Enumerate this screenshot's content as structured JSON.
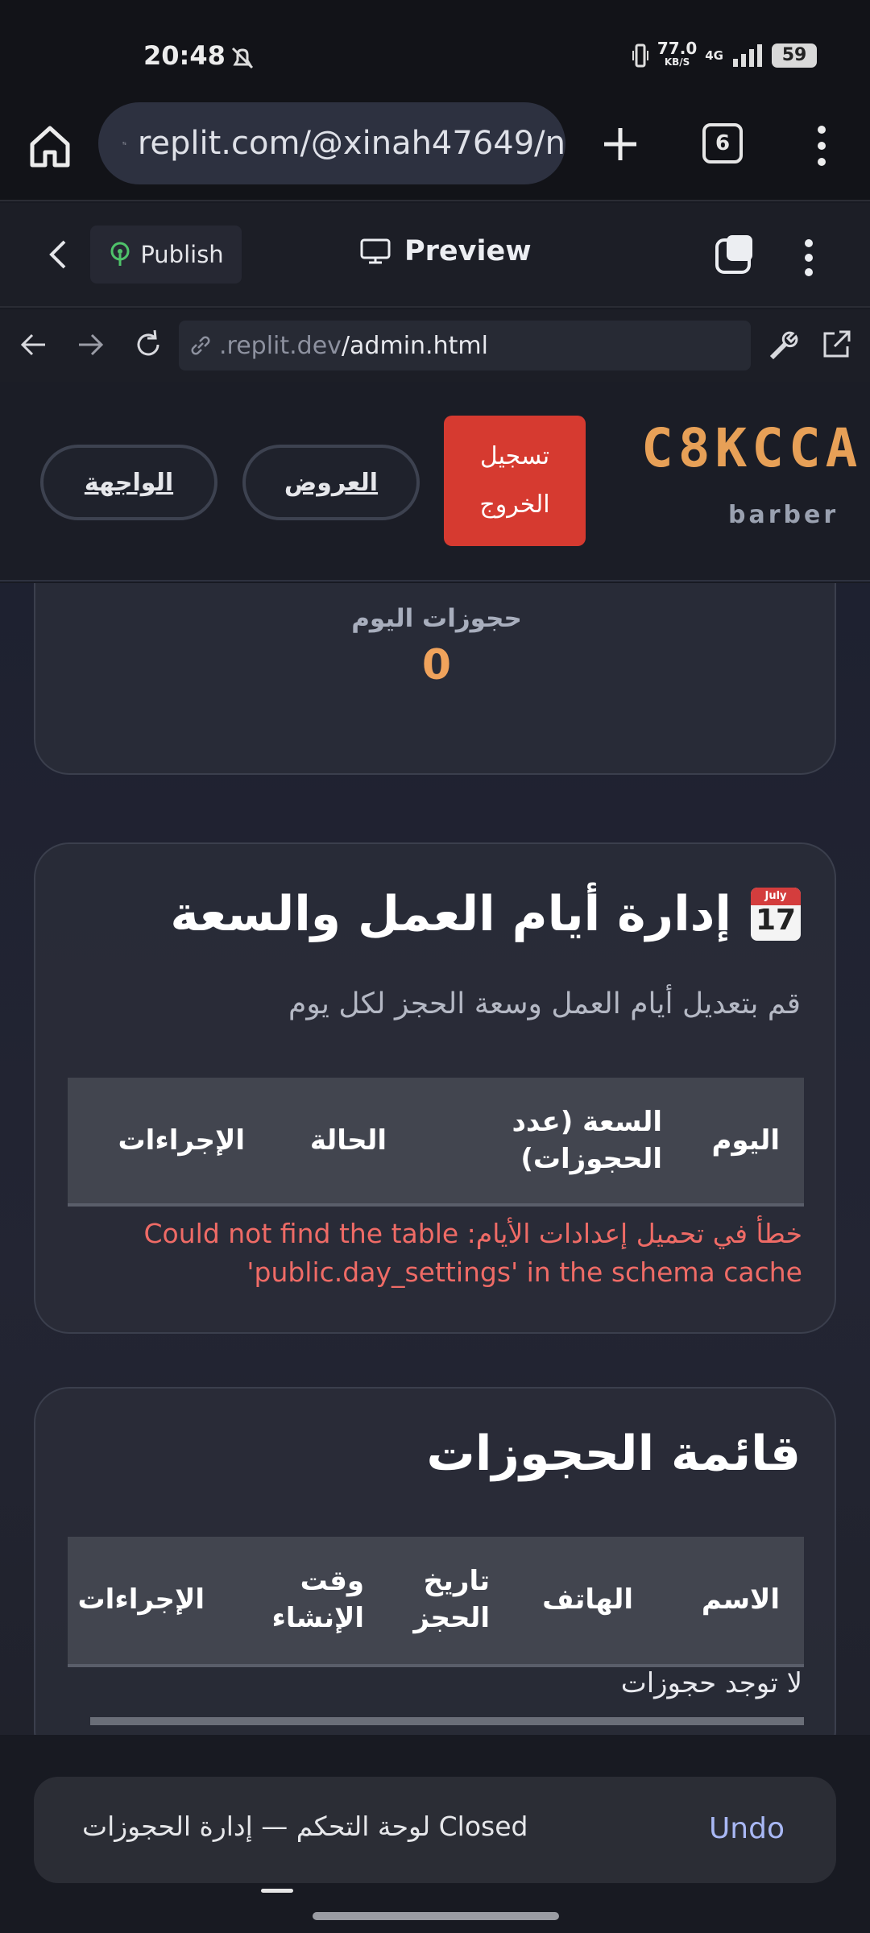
{
  "status": {
    "time": "20:48",
    "net_speed": "77.0",
    "net_unit": "KB/S",
    "lte": "4G",
    "battery": "59"
  },
  "browser": {
    "url": "replit.com/@xinah47649/n",
    "tab_count": "6"
  },
  "replit": {
    "publish_label": "Publish",
    "preview_label": "Preview",
    "addr_domain": ".replit.dev",
    "addr_path": "/admin.html"
  },
  "header": {
    "logo": "C8KCCA",
    "logo_sub": "barber",
    "logout_label": "تسجيل الخروج",
    "nav_offers": "العروض",
    "nav_home": "الواجهة"
  },
  "stats": {
    "today_label": "حجوزات اليوم",
    "today_value": "0"
  },
  "days": {
    "calendar_month": "July",
    "calendar_day": "17",
    "title": "إدارة أيام العمل والسعة",
    "subtitle": "قم بتعديل أيام العمل وسعة الحجز لكل يوم",
    "columns": [
      "اليوم",
      "السعة (عدد الحجوزات)",
      "الحالة",
      "الإجراءات"
    ],
    "error": "خطأ في تحميل إعدادات الأيام: Could not find the table 'public.day_settings' in the schema cache"
  },
  "bookings": {
    "title": "قائمة الحجوزات",
    "columns": [
      "الاسم",
      "الهاتف",
      "تاريخ الحجز",
      "وقت الإنشاء",
      "الإجراءات"
    ],
    "empty": "لا توجد حجوزات"
  },
  "snackbar": {
    "text": "لوحة التحكم — إدارة الحجوزات Closed",
    "undo": "Undo"
  },
  "colors": {
    "accent": "#f0a35c",
    "logout": "#d63a30",
    "error": "#ef6b66",
    "undo": "#a9b8f5"
  }
}
